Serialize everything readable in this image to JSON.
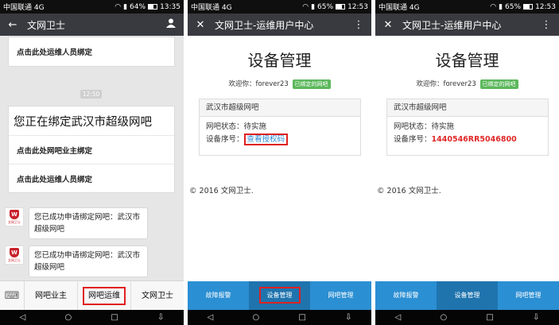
{
  "panel1": {
    "status": {
      "carrier": "中国联通 4G",
      "battery": "64%",
      "time": "13:35",
      "battery_level": 0.64
    },
    "title": "文网卫士",
    "top_card": {
      "row": "点击此处运维人员绑定"
    },
    "timestamp": "12:50",
    "main_card": {
      "headline": "您正在绑定武汉市超级网吧",
      "row1": "点击此处网吧业主绑定",
      "row2": "点击此处运维人员绑定"
    },
    "messages": [
      {
        "avatar_label": "文网卫士",
        "text": "您已成功申请绑定网吧：武汉市超级网吧"
      },
      {
        "avatar_label": "文网卫士",
        "text": "您已成功申请绑定网吧：武汉市超级网吧"
      }
    ],
    "tabs": [
      "网吧业主",
      "网吧运维",
      "文网卫士"
    ]
  },
  "panel2": {
    "status": {
      "carrier": "中国联通 4G",
      "battery": "65%",
      "time": "12:53",
      "battery_level": 0.65
    },
    "title": "文网卫士-运维用户中心",
    "heading": "设备管理",
    "welcome": "欢迎你：forever23",
    "badge": "已绑定的网吧",
    "card_title": "武汉市超级网吧",
    "status_label": "网吧状态：",
    "status_value": "待实施",
    "serial_label": "设备序号：",
    "serial_link": "查看授权码",
    "copyright": "© 2016 文网卫士.",
    "nav": [
      "故障报警",
      "设备管理",
      "网吧管理"
    ]
  },
  "panel3": {
    "status": {
      "carrier": "中国联通 4G",
      "battery": "65%",
      "time": "12:53",
      "battery_level": 0.65
    },
    "title": "文网卫士-运维用户中心",
    "heading": "设备管理",
    "welcome": "欢迎你：forever23",
    "badge": "已绑定的网吧",
    "card_title": "武汉市超级网吧",
    "status_label": "网吧状态：",
    "status_value": "待实施",
    "serial_label": "设备序号：",
    "serial_value": "1440546RR5046800",
    "copyright": "© 2016 文网卫士.",
    "nav": [
      "故障报警",
      "设备管理",
      "网吧管理"
    ]
  },
  "icons": {
    "back": "arrow-left-icon",
    "person": "person-icon",
    "close": "close-icon",
    "more": "more-vertical-icon",
    "keyboard": "keyboard-icon"
  },
  "colors": {
    "titlebar": "#393a3f",
    "bottomnav": "#2b8fd3",
    "bottomnav_active": "#1f74ae",
    "badge": "#5cb85c",
    "highlight_box": "#e02020",
    "serial": "#e02828",
    "link": "#2a8ad4"
  }
}
